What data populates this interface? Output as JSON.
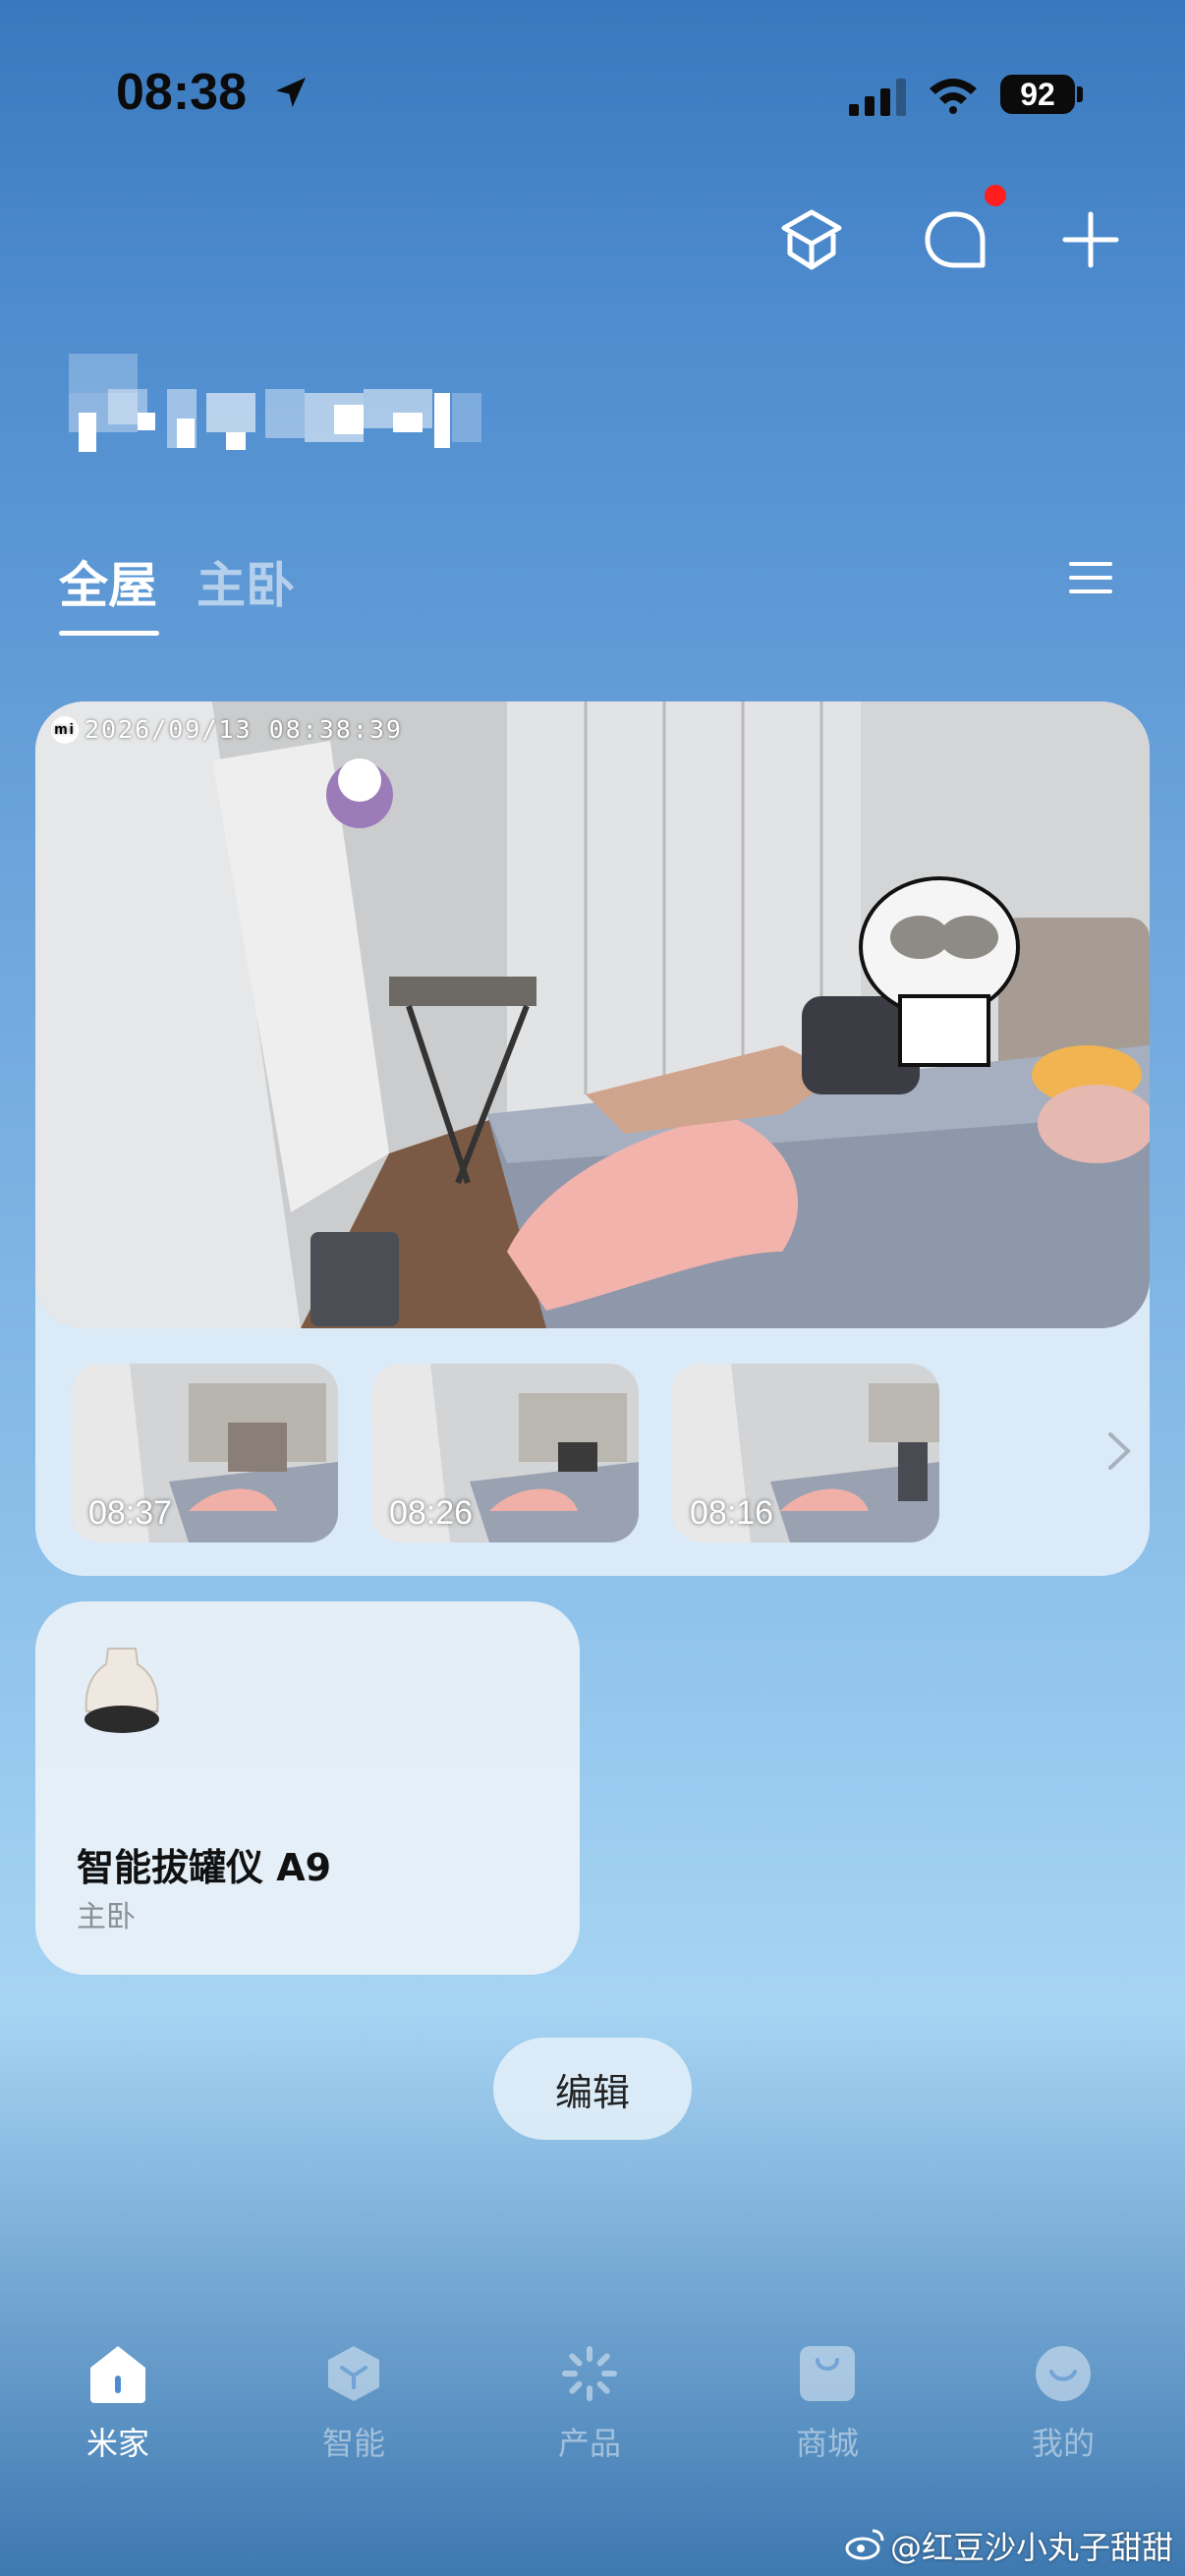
{
  "status_bar": {
    "time": "08:38",
    "battery": "92"
  },
  "header": {
    "icons": [
      "home-box-icon",
      "chat-bubble-icon",
      "plus-icon"
    ],
    "notification_color": "#ff1e1e"
  },
  "tabs": [
    {
      "label": "全屋",
      "active": true
    },
    {
      "label": "主卧",
      "active": false
    }
  ],
  "camera": {
    "timestamp": "2026/09/13  08:38:39",
    "logo": "mi",
    "thumbnails": [
      {
        "time": "08:37"
      },
      {
        "time": "08:26"
      },
      {
        "time": "08:16"
      }
    ]
  },
  "device": {
    "name": "智能拔罐仪 A9",
    "room": "主卧"
  },
  "edit_button": "编辑",
  "bottom_nav": [
    {
      "label": "米家",
      "icon": "home-icon",
      "active": true
    },
    {
      "label": "智能",
      "icon": "smart-cube-icon",
      "active": false
    },
    {
      "label": "产品",
      "icon": "product-sparkle-icon",
      "active": false
    },
    {
      "label": "商城",
      "icon": "shopping-bag-icon",
      "active": false
    },
    {
      "label": "我的",
      "icon": "profile-smile-icon",
      "active": false
    }
  ],
  "watermark": "@红豆沙小丸子甜甜"
}
